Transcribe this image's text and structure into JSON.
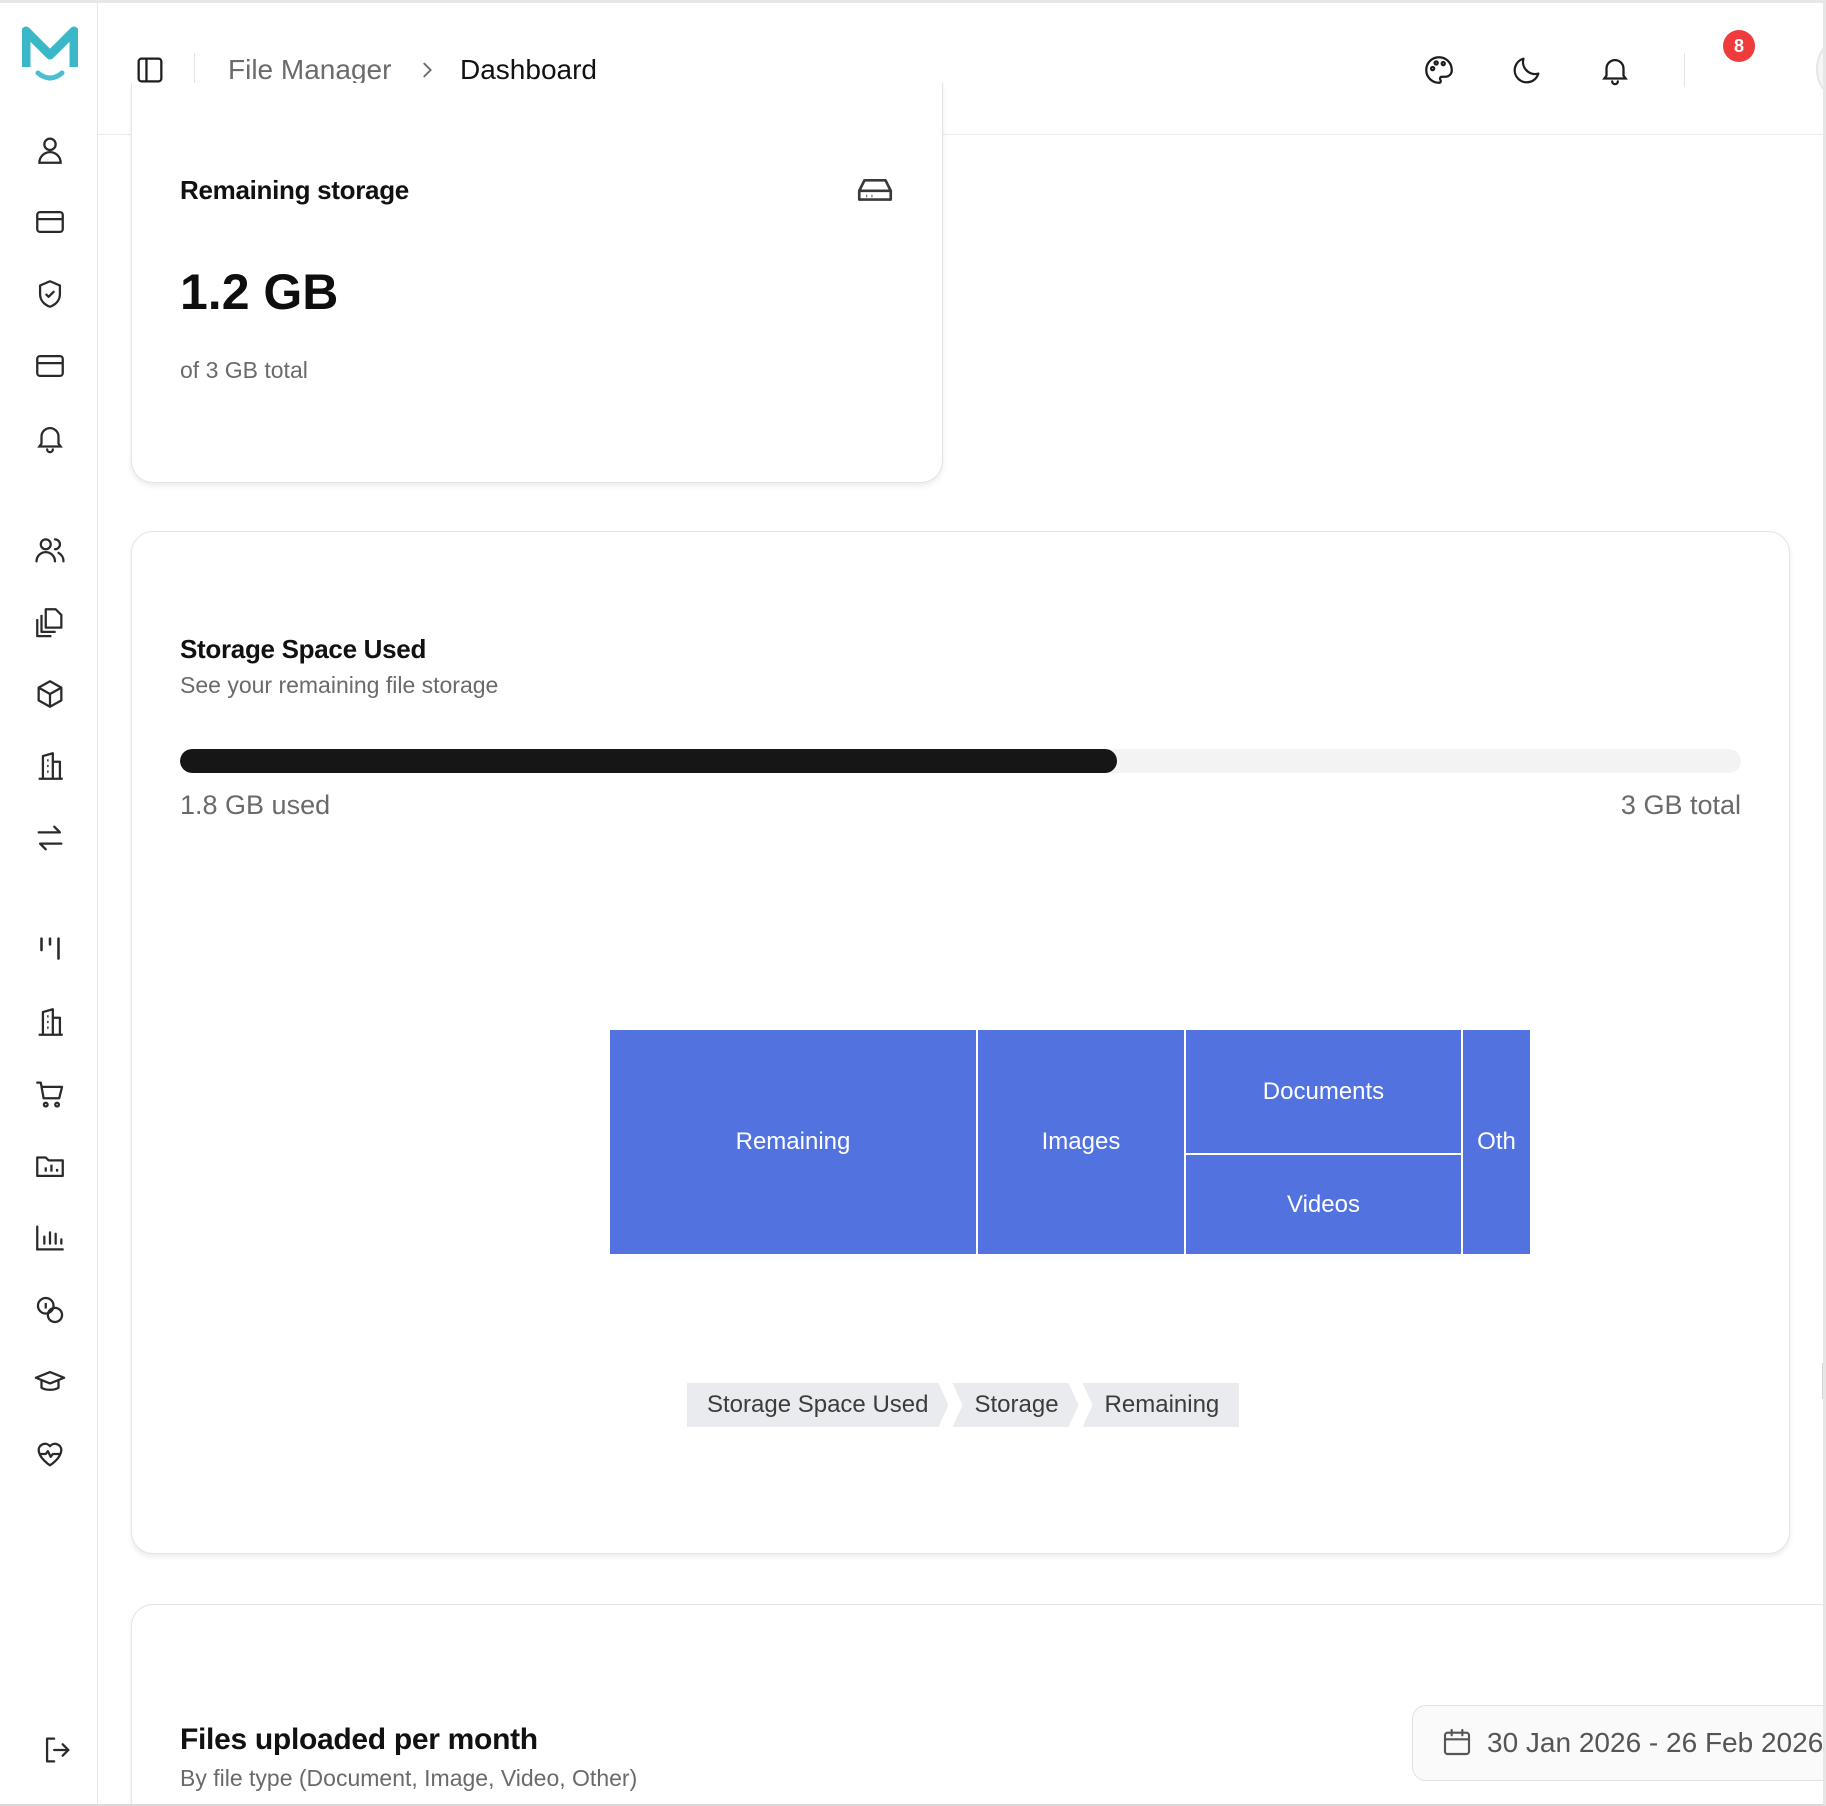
{
  "brand": {
    "logo_letter": "M",
    "colors": {
      "logo": "#3ab8c8",
      "smile": "#49c0d0"
    }
  },
  "header": {
    "breadcrumb": {
      "parent": "File Manager",
      "current": "Dashboard"
    },
    "notification_count": "8",
    "icons": [
      "sidebar-toggle-icon",
      "palette-icon",
      "moon-icon",
      "bell-icon",
      "avatar"
    ]
  },
  "sidebar": {
    "items": [
      "user-icon",
      "card-icon",
      "shield-icon",
      "wallet-icon",
      "bell-icon",
      "users-icon",
      "files-icon",
      "box-icon",
      "building-icon",
      "transfer-icon",
      "kanban-icon",
      "building-icon",
      "cart-icon",
      "folder-chart-icon",
      "bar-chart-icon",
      "coins-icon",
      "graduation-cap-icon",
      "heart-pulse-icon",
      "logout-icon"
    ]
  },
  "remaining_card": {
    "title": "Remaining storage",
    "value": "1.2 GB",
    "caption": "of 3 GB total"
  },
  "storage_card": {
    "title": "Storage Space Used",
    "subtitle": "See your remaining file storage",
    "used_label": "1.8 GB used",
    "total_label": "3 GB total",
    "used_fraction": 0.6,
    "treemap_breadcrumb": [
      "Storage Space Used",
      "Storage",
      "Remaining"
    ],
    "accent": "#5272e0"
  },
  "chart_data": {
    "type": "treemap",
    "title": "",
    "cells": [
      {
        "name": "Remaining",
        "label": "Remaining"
      },
      {
        "name": "Images",
        "label": "Images"
      },
      {
        "name": "Documents",
        "label": "Documents"
      },
      {
        "name": "Videos",
        "label": "Videos"
      },
      {
        "name": "Other",
        "label": "Oth"
      }
    ]
  },
  "uploads_card": {
    "title": "Files uploaded per month",
    "subtitle": "By file type (Document, Image, Video, Other)",
    "date_range": "30 Jan 2026 - 26 Feb 2026"
  }
}
